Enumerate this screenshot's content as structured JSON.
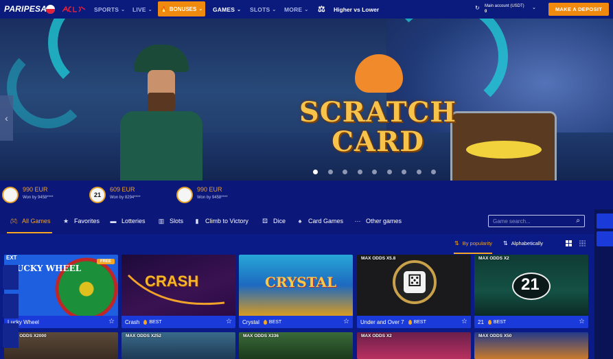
{
  "header": {
    "logo": "PARIPESA",
    "brandmark": "AC",
    "nav": [
      {
        "label": "SPORTS"
      },
      {
        "label": "LIVE"
      },
      {
        "label": "BONUSES"
      },
      {
        "label": "GAMES"
      },
      {
        "label": "SLOTS"
      },
      {
        "label": "MORE"
      }
    ],
    "promo_game": "Higher vs Lower",
    "account_label": "Main account (USDT)",
    "account_balance": "0",
    "deposit_label": "MAKE A DEPOSIT",
    "accent_color": "#f08a0e"
  },
  "hero": {
    "title_line1": "SCRATCH",
    "title_line2": "CARD",
    "slide_count": 9,
    "active_slide": 0
  },
  "winners": [
    {
      "amount": "990 EUR",
      "who": "Won by 9458****",
      "chip": ""
    },
    {
      "amount": "609 EUR",
      "who": "Won by 8294****",
      "chip": "21"
    },
    {
      "amount": "990 EUR",
      "who": "Won by 9458****",
      "chip": ""
    }
  ],
  "categories": [
    {
      "label": "All Games",
      "icon": "gamepad-icon"
    },
    {
      "label": "Favorites",
      "icon": "star-icon"
    },
    {
      "label": "Lotteries",
      "icon": "ticket-icon"
    },
    {
      "label": "Slots",
      "icon": "slot-reels-icon"
    },
    {
      "label": "Climb to Victory",
      "icon": "chart-up-icon"
    },
    {
      "label": "Dice",
      "icon": "dice-icon"
    },
    {
      "label": "Card Games",
      "icon": "spade-icon"
    },
    {
      "label": "Other games",
      "icon": "dots-icon"
    }
  ],
  "search": {
    "placeholder": "Game search..."
  },
  "sort": {
    "popularity": "By popularity",
    "alphabetical": "Alphabetically"
  },
  "games_row1": [
    {
      "name": "Lucky Wheel",
      "badge": "",
      "tag": "",
      "new": "FREE",
      "art": "LUCKY WHEEL"
    },
    {
      "name": "Crash",
      "badge": "",
      "tag": "BEST",
      "new": "",
      "art": "CRASH"
    },
    {
      "name": "Crystal",
      "badge": "",
      "tag": "BEST",
      "new": "",
      "art": "CRYSTAL"
    },
    {
      "name": "Under and Over 7",
      "badge": "MAX ODDS X5.8",
      "tag": "BEST",
      "new": "",
      "art": ""
    },
    {
      "name": "21",
      "badge": "MAX ODDS X2",
      "tag": "BEST",
      "new": "",
      "art": "21"
    }
  ],
  "games_row2": [
    {
      "badge": "MAX ODDS X2000"
    },
    {
      "badge": "MAX ODDS X252"
    },
    {
      "badge": "MAX ODDS X336"
    },
    {
      "badge": "MAX ODDS X2"
    },
    {
      "badge": "MAX ODDS X50"
    }
  ],
  "right_rail": {
    "label": "EXT"
  }
}
